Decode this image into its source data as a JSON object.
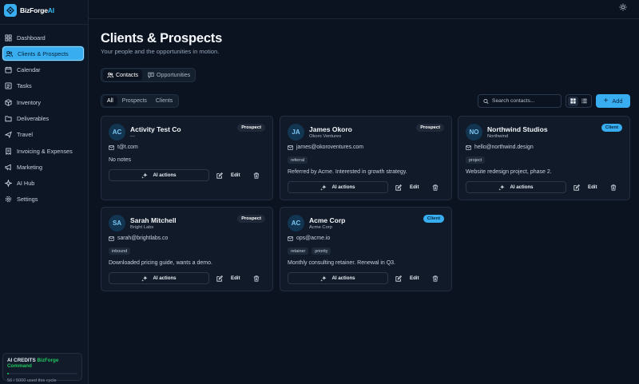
{
  "brand": {
    "name_main": "BizForge",
    "name_ai": "AI"
  },
  "sidebar": {
    "items": [
      {
        "label": "Dashboard",
        "icon": "grid-icon"
      },
      {
        "label": "Clients & Prospects",
        "icon": "users-icon",
        "active": true
      },
      {
        "label": "Calendar",
        "icon": "calendar-icon"
      },
      {
        "label": "Tasks",
        "icon": "tasks-icon"
      },
      {
        "label": "Inventory",
        "icon": "box-icon"
      },
      {
        "label": "Deliverables",
        "icon": "folder-icon"
      },
      {
        "label": "Travel",
        "icon": "plane-icon"
      },
      {
        "label": "Invoicing & Expenses",
        "icon": "receipt-icon"
      },
      {
        "label": "Marketing",
        "icon": "megaphone-icon"
      },
      {
        "label": "AI Hub",
        "icon": "sparkle-icon"
      },
      {
        "label": "Settings",
        "icon": "gear-icon"
      }
    ],
    "credits": {
      "title": "AI CREDITS",
      "plan": "BizForge Command",
      "used": "56 / 5000 used this cycle",
      "fraction": 0.0112
    }
  },
  "header": {
    "title": "Clients & Prospects",
    "subtitle": "Your people and the opportunities in motion."
  },
  "tabs": [
    {
      "label": "Contacts",
      "icon": "users-icon",
      "active": true
    },
    {
      "label": "Opportunities",
      "icon": "chat-icon",
      "active": false
    }
  ],
  "filters": [
    {
      "label": "All",
      "active": true
    },
    {
      "label": "Prospects",
      "active": false
    },
    {
      "label": "Clients",
      "active": false
    }
  ],
  "search": {
    "placeholder": "Search contacts...",
    "value": ""
  },
  "add_label": "Add",
  "card_actions": {
    "ai": "AI actions",
    "edit": "Edit"
  },
  "contacts": [
    {
      "initials": "AC",
      "name": "Activity Test Co",
      "company": "—",
      "status": "Prospect",
      "email": "t@t.com",
      "tags": [],
      "note": "No notes"
    },
    {
      "initials": "JA",
      "name": "James Okoro",
      "company": "Okoro Ventures",
      "status": "Prospect",
      "email": "james@okoroventures.com",
      "tags": [
        "referral"
      ],
      "note": "Referred by Acme. Interested in growth strategy."
    },
    {
      "initials": "NO",
      "name": "Northwind Studios",
      "company": "Northwind",
      "status": "Client",
      "email": "hello@northwind.design",
      "tags": [
        "project"
      ],
      "note": "Website redesign project, phase 2."
    },
    {
      "initials": "SA",
      "name": "Sarah Mitchell",
      "company": "Bright Labs",
      "status": "Prospect",
      "email": "sarah@brightlabs.co",
      "tags": [
        "inbound"
      ],
      "note": "Downloaded pricing guide, wants a demo."
    },
    {
      "initials": "AC",
      "name": "Acme Corp",
      "company": "Acme Corp",
      "status": "Client",
      "email": "ops@acme.io",
      "tags": [
        "retainer",
        "priority"
      ],
      "note": "Monthly consulting retainer. Renewal in Q3."
    }
  ],
  "colors": {
    "accent": "#38aef0",
    "background": "#0b1320",
    "card": "#111a28",
    "credits": "#22c55e"
  }
}
